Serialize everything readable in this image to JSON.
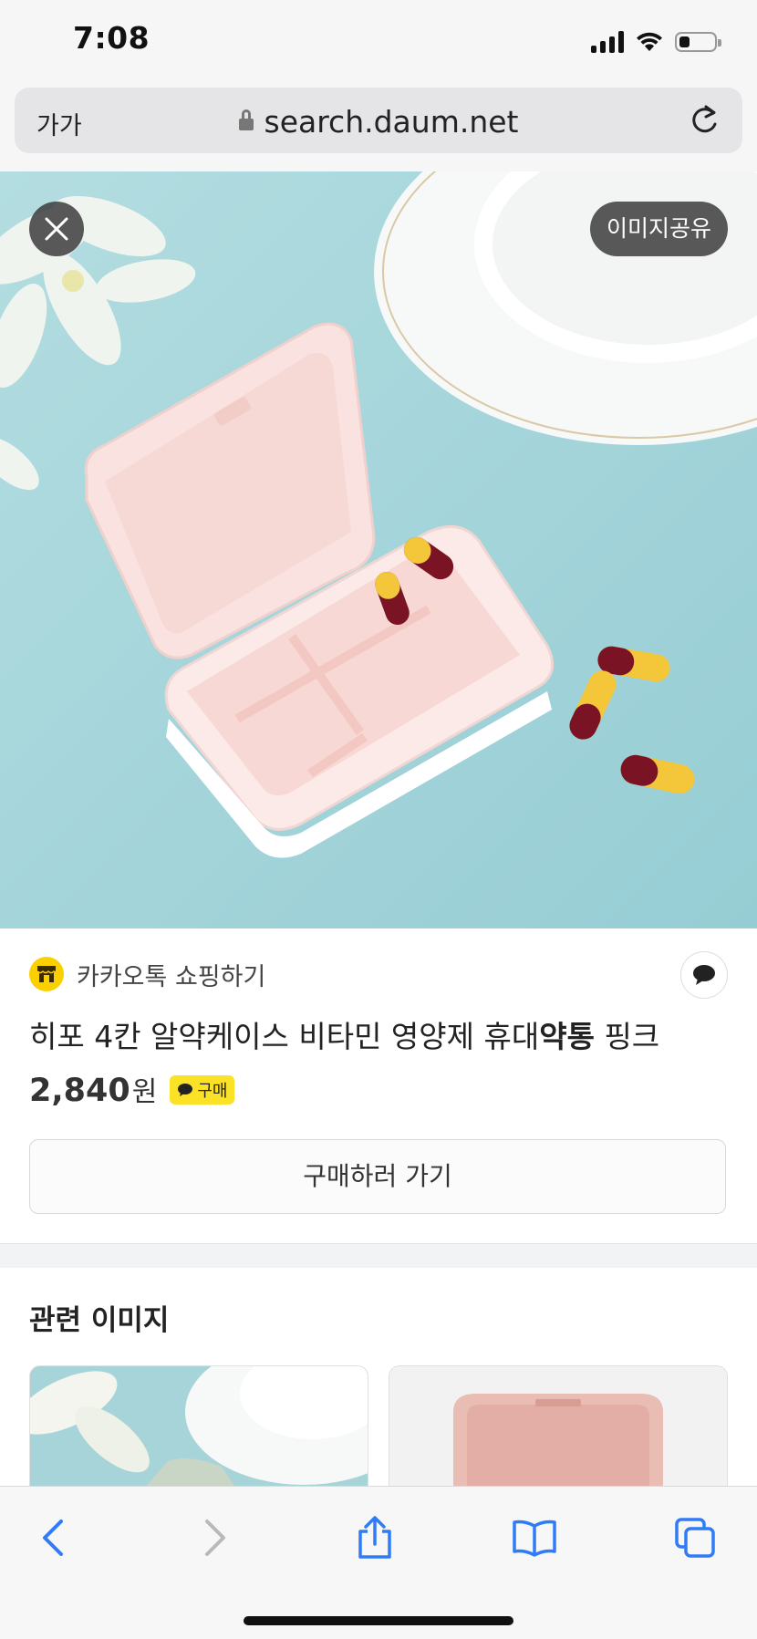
{
  "status_bar": {
    "time": "7:08",
    "battery_level": 0.3
  },
  "browser": {
    "text_size_label": "가가",
    "url": "search.daum.net"
  },
  "viewer": {
    "share_label": "이미지공유"
  },
  "product": {
    "shop_name": "카카오톡 쇼핑하기",
    "title_before": "히포 4칸 알약케이스 비타민 영양제 휴대",
    "title_bold": "약통",
    "title_after": " 핑크",
    "price": "2,840",
    "price_unit": "원",
    "badge_label": "구매",
    "purchase_label": "구매하러 가기"
  },
  "related": {
    "title": "관련 이미지"
  },
  "colors": {
    "accent_blue": "#2f7cf6",
    "badge_yellow": "#fbe227",
    "image_bg": "#a8d6dc"
  },
  "icons": [
    "lock-icon",
    "reload-icon",
    "close-icon",
    "store-icon",
    "chat-icon",
    "back-icon",
    "forward-icon",
    "share-icon",
    "bookmarks-icon",
    "tabs-icon"
  ]
}
